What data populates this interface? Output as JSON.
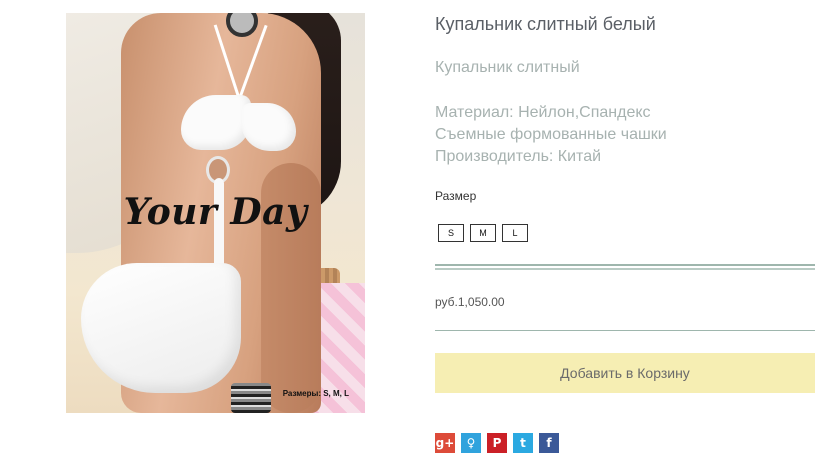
{
  "product": {
    "title": "Купальник слитный белый",
    "subtitle": "Купальник слитный",
    "specs": [
      "Материал: Нейлон,Спандекс",
      "Съемные формованные чашки",
      "Производитель: Китай"
    ],
    "image": {
      "overlay_title": "Your Day",
      "overlay_sizes": "Размеры: S, M, L"
    }
  },
  "size_selector": {
    "label": "Размер",
    "options": [
      "S",
      "M",
      "L"
    ]
  },
  "price": "руб.1,050.00",
  "add_to_cart_label": "Добавить в Корзину",
  "share": {
    "icons": [
      {
        "name": "google-plus-icon",
        "glyph": "g+",
        "color": "#dd4b39"
      },
      {
        "name": "odnoklassniki-icon",
        "glyph": "♀",
        "color": "#30a3dd"
      },
      {
        "name": "pinterest-icon",
        "glyph": "P",
        "color": "#cb2027"
      },
      {
        "name": "twitter-icon",
        "glyph": "t",
        "color": "#2ba9e1"
      },
      {
        "name": "facebook-icon",
        "glyph": "f",
        "color": "#3b5998"
      }
    ]
  }
}
